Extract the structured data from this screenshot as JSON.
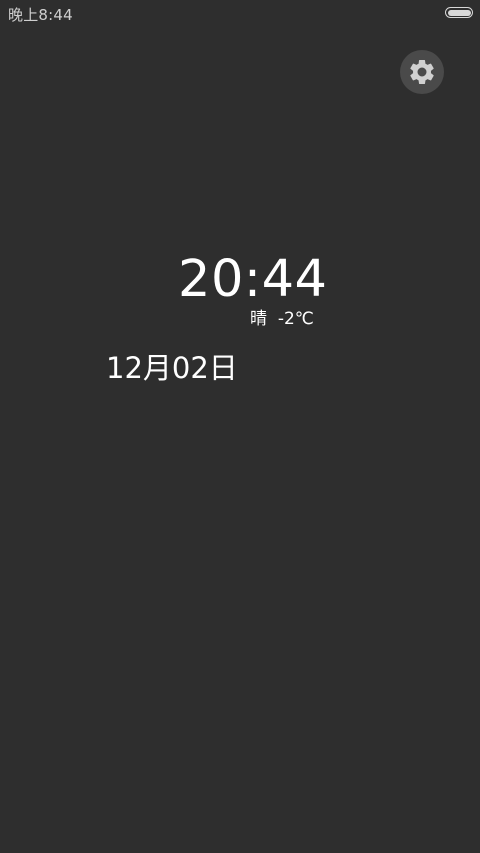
{
  "status_bar": {
    "time": "晚上8:44",
    "battery_icon": "battery-full-icon"
  },
  "settings": {
    "icon": "gear-icon"
  },
  "clock": {
    "time": "20:44",
    "weather_condition": "晴",
    "temperature": "-2℃",
    "date": "12月02日"
  },
  "colors": {
    "background": "#2e2e2e",
    "text": "#ffffff",
    "button_bg": "#4a4a4a",
    "icon": "#d0d0d0"
  }
}
